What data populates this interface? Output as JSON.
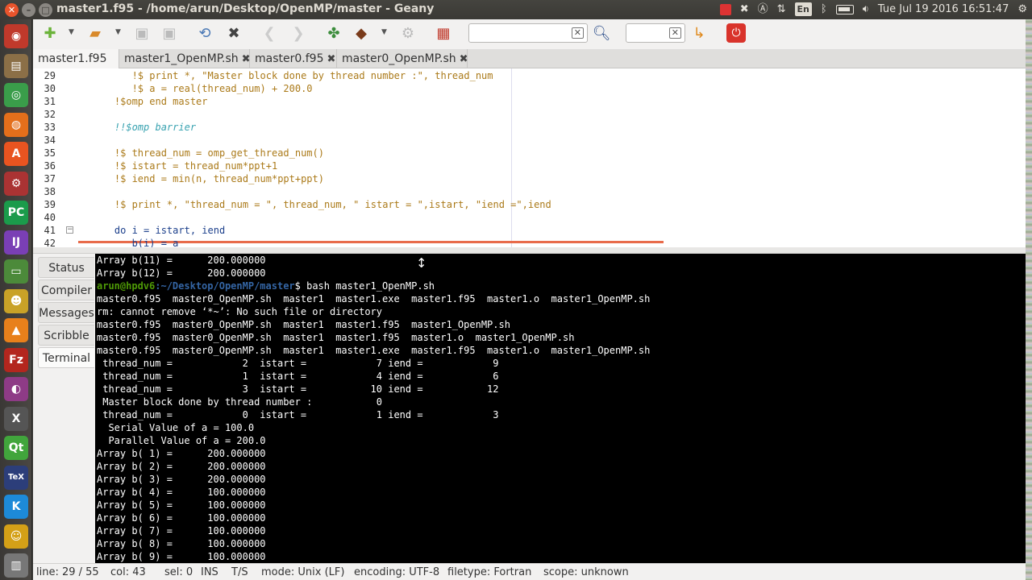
{
  "window": {
    "title": "master1.f95 - /home/arun/Desktop/OpenMP/master - Geany"
  },
  "panel": {
    "keyboard": "En",
    "datetime": "Tue Jul 19 2016 16:51:47"
  },
  "toolbar": {
    "search_value": "",
    "goto_value": ""
  },
  "tabs": [
    {
      "label": "master1.f95",
      "active": true
    },
    {
      "label": "master1_OpenMP.sh",
      "active": false
    },
    {
      "label": "master0.f95",
      "active": false
    },
    {
      "label": "master0_OpenMP.sh",
      "active": false
    }
  ],
  "editor": {
    "lines": [
      {
        "num": "29",
        "text": "       !$ print *, \"Master block done by thread number :\", thread_num",
        "style": "tx"
      },
      {
        "num": "30",
        "text": "       !$ a = real(thread_num) + 200.0",
        "style": "tx"
      },
      {
        "num": "31",
        "text": "    !$omp end master",
        "style": "tx"
      },
      {
        "num": "32",
        "text": "",
        "style": "tx"
      },
      {
        "num": "33",
        "text": "    !!$omp barrier",
        "style": "cm"
      },
      {
        "num": "34",
        "text": "",
        "style": "tx"
      },
      {
        "num": "35",
        "text": "    !$ thread_num = omp_get_thread_num()",
        "style": "tx"
      },
      {
        "num": "36",
        "text": "    !$ istart = thread_num*ppt+1",
        "style": "tx"
      },
      {
        "num": "37",
        "text": "    !$ iend = min(n, thread_num*ppt+ppt)",
        "style": "tx"
      },
      {
        "num": "38",
        "text": "",
        "style": "tx"
      },
      {
        "num": "39",
        "text": "    !$ print *, \"thread_num = \", thread_num, \" istart = \",istart, \"iend =\",iend",
        "style": "tx"
      },
      {
        "num": "40",
        "text": "",
        "style": "tx"
      },
      {
        "num": "41",
        "text": "    do i = istart, iend",
        "style": "kw"
      },
      {
        "num": "42",
        "text": "       b(i) = a",
        "style": "kw"
      }
    ]
  },
  "message_tabs": [
    "Status",
    "Compiler",
    "Messages",
    "Scribble",
    "Terminal"
  ],
  "terminal": {
    "lines": [
      "Array b(11) =      200.000000",
      "Array b(12) =      200.000000",
      "master0.f95  master0_OpenMP.sh  master1  master1.exe  master1.f95  master1.o  master1_OpenMP.sh",
      "rm: cannot remove ‘*~’: No such file or directory",
      "master0.f95  master0_OpenMP.sh  master1  master1.f95  master1_OpenMP.sh",
      "master0.f95  master0_OpenMP.sh  master1  master1.f95  master1.o  master1_OpenMP.sh",
      "master0.f95  master0_OpenMP.sh  master1  master1.exe  master1.f95  master1.o  master1_OpenMP.sh",
      " thread_num =            2  istart =            7 iend =            9",
      " thread_num =            1  istart =            4 iend =            6",
      " thread_num =            3  istart =           10 iend =           12",
      " Master block done by thread number :           0",
      " thread_num =            0  istart =            1 iend =            3",
      "  Serial Value of a = 100.0",
      "  Parallel Value of a = 200.0",
      "Array b( 1) =      200.000000",
      "Array b( 2) =      200.000000",
      "Array b( 3) =      200.000000",
      "Array b( 4) =      100.000000",
      "Array b( 5) =      100.000000",
      "Array b( 6) =      100.000000",
      "Array b( 7) =      100.000000",
      "Array b( 8) =      100.000000",
      "Array b( 9) =      100.000000"
    ],
    "prompt_user": "arun@hpdv6",
    "prompt_path": ":~/Desktop/OpenMP/master",
    "prompt_cmd": "$ bash master1_OpenMP.sh"
  },
  "status": {
    "line": "line: 29 / 55",
    "col": "col: 43",
    "sel": "sel: 0",
    "ins": "INS",
    "ts": "T/S",
    "mode": "mode: Unix (LF)",
    "encoding": "encoding: UTF-8",
    "filetype": "filetype: Fortran",
    "scope": "scope: unknown"
  },
  "launcher": [
    {
      "name": "dash-icon",
      "glyph": "◉",
      "color": "#c0392b"
    },
    {
      "name": "files-icon",
      "glyph": "▤",
      "color": "#8b6f47"
    },
    {
      "name": "chrome-icon",
      "glyph": "◎",
      "color": "#3a9d4a"
    },
    {
      "name": "firefox-icon",
      "glyph": "◍",
      "color": "#e46f1b"
    },
    {
      "name": "software-center-icon",
      "glyph": "A",
      "color": "#e95420"
    },
    {
      "name": "settings-icon",
      "glyph": "⚙",
      "color": "#a33"
    },
    {
      "name": "pycharm-icon",
      "glyph": "PC",
      "color": "#1b9b4b"
    },
    {
      "name": "intellij-icon",
      "glyph": "IJ",
      "color": "#7a3fb5"
    },
    {
      "name": "drive-icon",
      "glyph": "▭",
      "color": "#4c8a3a"
    },
    {
      "name": "meld-icon",
      "glyph": "☻",
      "color": "#c9a227"
    },
    {
      "name": "vlc-icon",
      "glyph": "▲",
      "color": "#e8801b"
    },
    {
      "name": "filezilla-icon",
      "glyph": "Fz",
      "color": "#b3261e"
    },
    {
      "name": "media-icon",
      "glyph": "◐",
      "color": "#8e3b86"
    },
    {
      "name": "xming-icon",
      "glyph": "X",
      "color": "#555"
    },
    {
      "name": "qt-icon",
      "glyph": "Qt",
      "color": "#41a53c"
    },
    {
      "name": "texmaker-icon",
      "glyph": "TeX",
      "color": "#2c3e7a"
    },
    {
      "name": "kde-icon",
      "glyph": "K",
      "color": "#1d8ad8"
    },
    {
      "name": "terminal-icon",
      "glyph": "☺",
      "color": "#d4a017"
    },
    {
      "name": "trash-icon",
      "glyph": "▥",
      "color": "#777"
    }
  ]
}
